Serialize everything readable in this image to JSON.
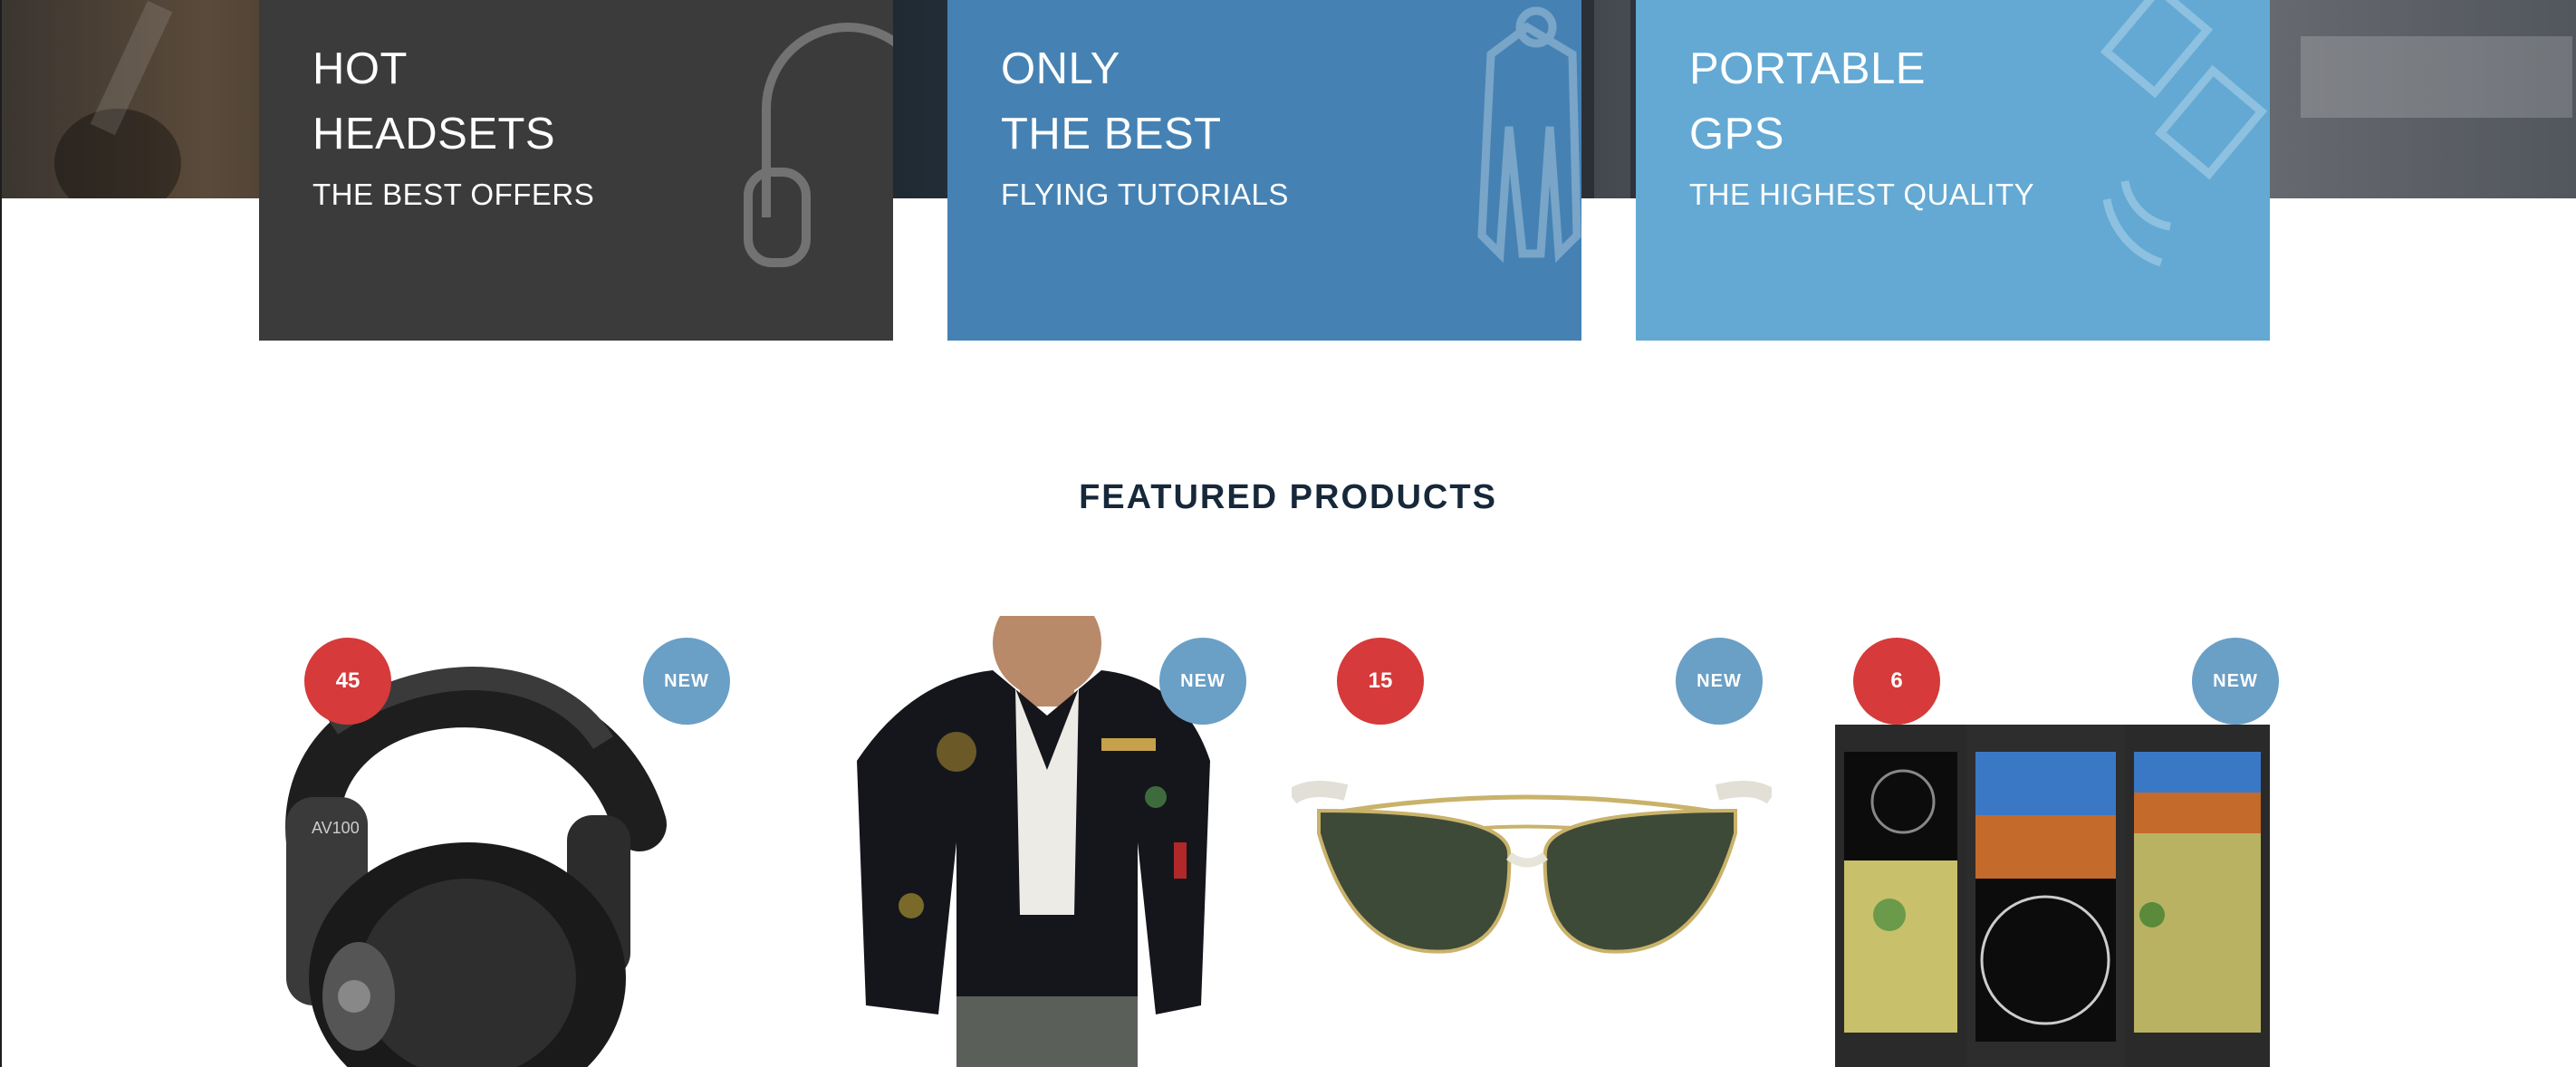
{
  "promos": [
    {
      "title_line1": "HOT",
      "title_line2": "HEADSETS",
      "subtitle": "THE BEST OFFERS",
      "color": "#3b3b3b",
      "icon": "headset-icon"
    },
    {
      "title_line1": "ONLY",
      "title_line2": "THE BEST",
      "subtitle": "FLYING TUTORIALS",
      "color": "#4582b3",
      "icon": "flight-suit-icon"
    },
    {
      "title_line1": "PORTABLE",
      "title_line2": "GPS",
      "subtitle": "THE HIGHEST QUALITY",
      "color": "#63a9d3",
      "icon": "satellite-icon"
    }
  ],
  "featured": {
    "title": "FEATURED PRODUCTS"
  },
  "products": [
    {
      "name": "headset",
      "count_badge": "45",
      "new_badge": "NEW"
    },
    {
      "name": "flight-jacket",
      "count_badge": "",
      "new_badge": "NEW"
    },
    {
      "name": "aviator-sunglasses",
      "count_badge": "15",
      "new_badge": "NEW"
    },
    {
      "name": "avionics-displays",
      "count_badge": "6",
      "new_badge": "NEW"
    }
  ],
  "colors": {
    "sale_badge": "#d63a3a",
    "new_badge": "#6a9fc6",
    "heading": "#16283a"
  }
}
